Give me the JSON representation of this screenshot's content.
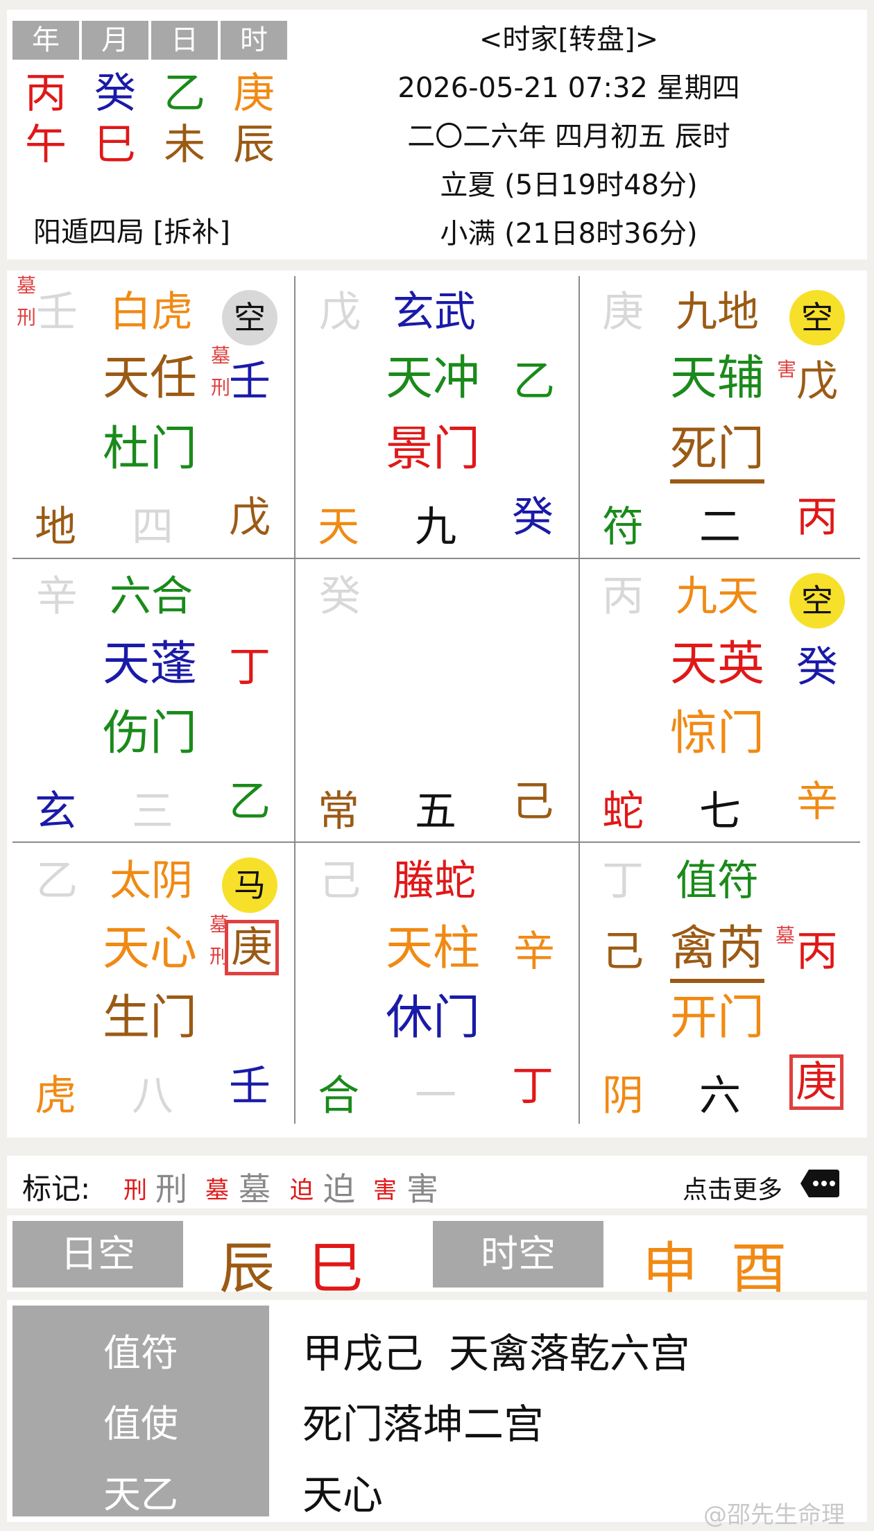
{
  "colors": {
    "red": "#e01818",
    "blue": "#1a1aa8",
    "green": "#1a8a1a",
    "orange": "#f08a14",
    "brown": "#9b5a14",
    "gray": "#b8b8b8",
    "black": "#111111",
    "yellow": "#f7e02a",
    "lightgray": "#d8d8d8"
  },
  "top": {
    "headers": [
      "年",
      "月",
      "日",
      "时"
    ],
    "stems": [
      "丙",
      "癸",
      "乙",
      "庚"
    ],
    "branches": [
      "午",
      "巳",
      "未",
      "辰"
    ],
    "ju": "阳遁四局 [拆补]",
    "title": "<时家[转盘]>",
    "datetime": "2026-05-21 07:32 星期四",
    "lunar": "二〇二六年 四月初五 辰时",
    "term1": "立夏 (5日19时48分)",
    "term2": "小满 (21日8时36分)"
  },
  "palaces": {
    "p1": {
      "stem": "壬",
      "god": "白虎",
      "kong": "空",
      "star": "天任",
      "star_stem": "壬",
      "door": "杜门",
      "left": "地",
      "mid": "四",
      "right": "戊",
      "marks_stem": [
        "墓",
        "刑"
      ],
      "marks_star": [
        "墓",
        "刑"
      ]
    },
    "p2": {
      "stem": "戊",
      "god": "玄武",
      "star": "天冲",
      "star_stem": "乙",
      "door": "景门",
      "left": "天",
      "mid": "九",
      "right": "癸"
    },
    "p3": {
      "stem": "庚",
      "god": "九地",
      "kong": "空",
      "star": "天辅",
      "star_mark": "害",
      "star_stem": "戊",
      "door": "死门",
      "left": "符",
      "mid": "二",
      "right": "丙"
    },
    "p4": {
      "stem": "辛",
      "god": "六合",
      "star": "天蓬",
      "star_stem": "丁",
      "door": "伤门",
      "left": "玄",
      "mid": "三",
      "right": "乙"
    },
    "p5": {
      "stem": "癸",
      "left": "常",
      "mid": "五",
      "right": "己"
    },
    "p6": {
      "stem": "丙",
      "god": "九天",
      "kong": "空",
      "star": "天英",
      "star_stem": "癸",
      "door": "惊门",
      "left": "蛇",
      "mid": "七",
      "right": "辛"
    },
    "p7": {
      "stem": "乙",
      "god": "太阴",
      "ma": "马",
      "star": "天心",
      "star_marks": [
        "墓",
        "刑"
      ],
      "star_stem": "庚",
      "door": "生门",
      "left": "虎",
      "mid": "八",
      "right": "壬"
    },
    "p8": {
      "stem": "己",
      "god": "螣蛇",
      "star": "天柱",
      "star_stem": "辛",
      "door": "休门",
      "left": "合",
      "mid": "一",
      "right": "丁"
    },
    "p9": {
      "stem": "丁",
      "god": "值符",
      "side_stem": "己",
      "star": "禽芮",
      "star_mark": "墓",
      "star_stem": "丙",
      "door": "开门",
      "left": "阴",
      "mid": "六",
      "right": "庚"
    }
  },
  "legend": {
    "label": "标记:",
    "items": [
      {
        "small": "刑",
        "big": "刑"
      },
      {
        "small": "墓",
        "big": "墓"
      },
      {
        "small": "迫",
        "big": "迫"
      },
      {
        "small": "害",
        "big": "害"
      }
    ],
    "more": "点击更多",
    "more_icon": "ellipsis-icon"
  },
  "kong": {
    "day_label": "日空",
    "day_values": [
      "辰",
      "巳"
    ],
    "hour_label": "时空",
    "hour_values": [
      "申",
      "酉"
    ]
  },
  "info": {
    "labels": [
      "值符",
      "值使",
      "天乙"
    ],
    "values": [
      "甲戌己  天禽落乾六宫",
      "死门落坤二宫",
      "天心"
    ]
  },
  "watermark": "@邵先生命理"
}
